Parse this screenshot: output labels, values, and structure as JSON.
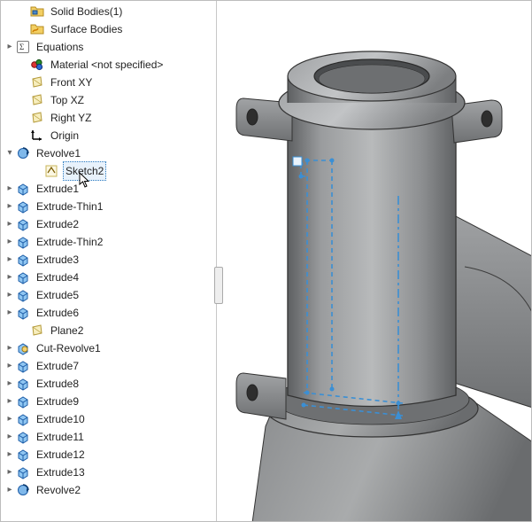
{
  "tree": [
    {
      "id": "solid-bodies",
      "label": "Solid Bodies(1)",
      "indent": 1,
      "expander": "none",
      "icon": "folder-solid",
      "selected": false
    },
    {
      "id": "surface-bodies",
      "label": "Surface Bodies",
      "indent": 1,
      "expander": "none",
      "icon": "folder-surface",
      "selected": false
    },
    {
      "id": "equations",
      "label": "Equations",
      "indent": 0,
      "expander": "closed",
      "icon": "equations",
      "selected": false
    },
    {
      "id": "material",
      "label": "Material <not specified>",
      "indent": 1,
      "expander": "none",
      "icon": "material",
      "selected": false
    },
    {
      "id": "front-xy",
      "label": "Front XY",
      "indent": 1,
      "expander": "none",
      "icon": "plane",
      "selected": false
    },
    {
      "id": "top-xz",
      "label": "Top XZ",
      "indent": 1,
      "expander": "none",
      "icon": "plane",
      "selected": false
    },
    {
      "id": "right-yz",
      "label": "Right YZ",
      "indent": 1,
      "expander": "none",
      "icon": "plane",
      "selected": false
    },
    {
      "id": "origin",
      "label": "Origin",
      "indent": 1,
      "expander": "none",
      "icon": "origin",
      "selected": false
    },
    {
      "id": "revolve1",
      "label": "Revolve1",
      "indent": 0,
      "expander": "open",
      "icon": "revolve",
      "selected": false
    },
    {
      "id": "sketch2",
      "label": "Sketch2",
      "indent": 2,
      "expander": "none",
      "icon": "sketch",
      "selected": true
    },
    {
      "id": "extrude1",
      "label": "Extrude1",
      "indent": 0,
      "expander": "closed",
      "icon": "extrude",
      "selected": false
    },
    {
      "id": "extrude-thin1",
      "label": "Extrude-Thin1",
      "indent": 0,
      "expander": "closed",
      "icon": "extrude",
      "selected": false
    },
    {
      "id": "extrude2",
      "label": "Extrude2",
      "indent": 0,
      "expander": "closed",
      "icon": "extrude",
      "selected": false
    },
    {
      "id": "extrude-thin2",
      "label": "Extrude-Thin2",
      "indent": 0,
      "expander": "closed",
      "icon": "extrude",
      "selected": false
    },
    {
      "id": "extrude3",
      "label": "Extrude3",
      "indent": 0,
      "expander": "closed",
      "icon": "extrude",
      "selected": false
    },
    {
      "id": "extrude4",
      "label": "Extrude4",
      "indent": 0,
      "expander": "closed",
      "icon": "extrude",
      "selected": false
    },
    {
      "id": "extrude5",
      "label": "Extrude5",
      "indent": 0,
      "expander": "closed",
      "icon": "extrude",
      "selected": false
    },
    {
      "id": "extrude6",
      "label": "Extrude6",
      "indent": 0,
      "expander": "closed",
      "icon": "extrude",
      "selected": false
    },
    {
      "id": "plane2",
      "label": "Plane2",
      "indent": 1,
      "expander": "none",
      "icon": "plane",
      "selected": false
    },
    {
      "id": "cut-revolve1",
      "label": "Cut-Revolve1",
      "indent": 0,
      "expander": "closed",
      "icon": "cut-revolve",
      "selected": false
    },
    {
      "id": "extrude7",
      "label": "Extrude7",
      "indent": 0,
      "expander": "closed",
      "icon": "extrude",
      "selected": false
    },
    {
      "id": "extrude8",
      "label": "Extrude8",
      "indent": 0,
      "expander": "closed",
      "icon": "extrude",
      "selected": false
    },
    {
      "id": "extrude9",
      "label": "Extrude9",
      "indent": 0,
      "expander": "closed",
      "icon": "extrude",
      "selected": false
    },
    {
      "id": "extrude10",
      "label": "Extrude10",
      "indent": 0,
      "expander": "closed",
      "icon": "extrude",
      "selected": false
    },
    {
      "id": "extrude11",
      "label": "Extrude11",
      "indent": 0,
      "expander": "closed",
      "icon": "extrude",
      "selected": false
    },
    {
      "id": "extrude12",
      "label": "Extrude12",
      "indent": 0,
      "expander": "closed",
      "icon": "extrude",
      "selected": false
    },
    {
      "id": "extrude13",
      "label": "Extrude13",
      "indent": 0,
      "expander": "closed",
      "icon": "extrude",
      "selected": false
    },
    {
      "id": "revolve2",
      "label": "Revolve2",
      "indent": 0,
      "expander": "closed",
      "icon": "revolve",
      "selected": false
    }
  ],
  "colors": {
    "sketch_highlight": "#3b8fd4",
    "model_mid": "#8a8c8e",
    "model_light": "#b2b4b6",
    "model_dark": "#5f6163"
  }
}
